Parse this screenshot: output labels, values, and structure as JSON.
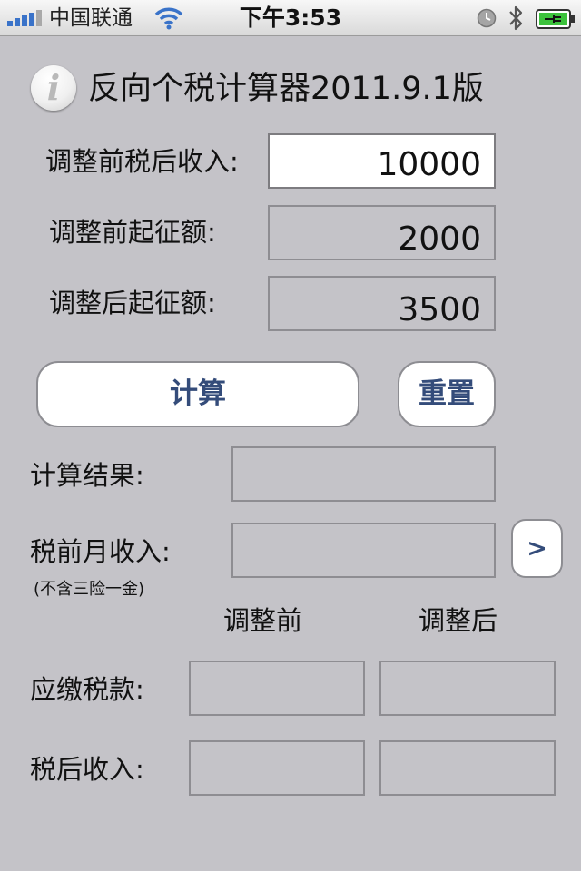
{
  "status_bar": {
    "carrier": "中国联通",
    "time": "下午3:53",
    "icons": [
      "signal-icon",
      "wifi-icon",
      "alarm-icon",
      "bluetooth-icon",
      "battery-charging-icon"
    ]
  },
  "header": {
    "info_icon_glyph": "i",
    "title": "反向个税计算器2011.9.1版"
  },
  "inputs": {
    "after_tax_income_label": "调整前税后收入:",
    "after_tax_income_value": "10000",
    "old_threshold_label": "调整前起征额:",
    "old_threshold_value": "2000",
    "new_threshold_label": "调整后起征额:",
    "new_threshold_value": "3500"
  },
  "actions": {
    "calculate_label": "计算",
    "reset_label": "重置",
    "detail_label": ">"
  },
  "results": {
    "result_label": "计算结果:",
    "result_value": "",
    "pretax_income_label": "税前月收入:",
    "pretax_income_note": "(不含三险一金)",
    "pretax_income_value": "",
    "col_before": "调整前",
    "col_after": "调整后",
    "tax_label": "应缴税款:",
    "tax_before": "",
    "tax_after": "",
    "net_income_label": "税后收入:",
    "net_before": "",
    "net_after": ""
  },
  "colors": {
    "background": "#c4c3c8",
    "button_text": "#344c7a",
    "field_border": "#8e8d92"
  }
}
